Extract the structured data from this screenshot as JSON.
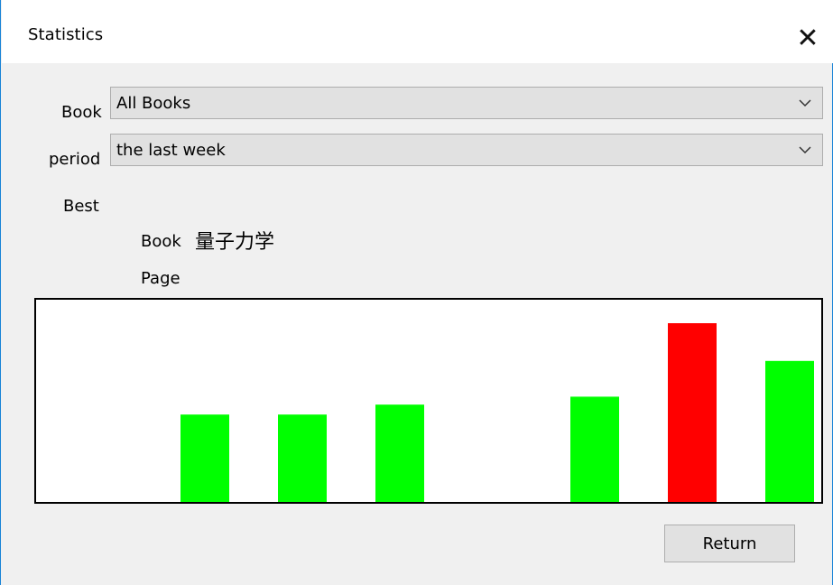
{
  "window": {
    "title": "Statistics",
    "close_icon": "close-icon"
  },
  "form": {
    "book_label": "Book",
    "book_value": "All Books",
    "period_label": "period",
    "period_value": "the last week"
  },
  "best": {
    "heading": "Best",
    "book_label": "Book",
    "book_value": "量子力学",
    "page_label": "Page",
    "page_value": ""
  },
  "chart_data": {
    "type": "bar",
    "categories": [
      "",
      "",
      "",
      "",
      "",
      "",
      "",
      ""
    ],
    "values": [
      0,
      0,
      44,
      44,
      49,
      0,
      53,
      90,
      71
    ],
    "colors": {
      "normal": "#00ff00",
      "best": "#ff0000"
    },
    "best_index": 7,
    "ylim": [
      0,
      100
    ],
    "grid": false
  },
  "buttons": {
    "return_label": "Return"
  }
}
